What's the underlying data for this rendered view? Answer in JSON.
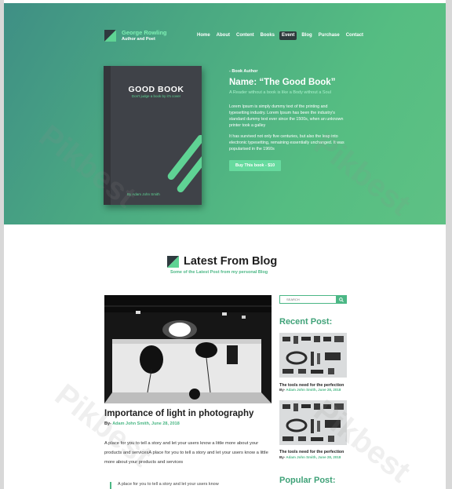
{
  "brand": {
    "name": "George Rowling",
    "role": "Author and Poet"
  },
  "nav": {
    "items": [
      "Home",
      "About",
      "Content",
      "Books",
      "Event",
      "Blog",
      "Purchase",
      "Contact"
    ],
    "active_index": 4
  },
  "book": {
    "title": "GOOD BOOK",
    "subtitle": "Don't judge a book by it's cover",
    "author": "By Adam John Smith"
  },
  "hero": {
    "kicker": "- Book Author",
    "heading": "Name: “The Good Book”",
    "tagline": "A Reader without a book is like a Body without a Soul",
    "para1": "Lorem Ipsum is simply dummy text of the printing and typesetting industry. Lorem Ipsum has been the industry's standard dummy text ever since the 1500s, when an unknown printer took a galley",
    "para2": "It has survived not only five centuries, but also the leap into electronic typesetting, remaining essentially unchanged. It was popularised in the 1960s",
    "buy_label": "Buy This book - $10"
  },
  "blog": {
    "title": "Latest From Blog",
    "subtitle": "Some of the Latest Post from my personal Blog",
    "post": {
      "title": "Importance of light in photography",
      "by": "By-",
      "meta": "Adam John Smith, June 28, 2018",
      "text": "A place for you to tell a story and let your users know a little more about your products and servicesA place for you to tell a story and let your users know a little more about your products and services",
      "quote": "A place for you to tell a story and let your users know"
    }
  },
  "sidebar": {
    "search_placeholder": "SEARCH",
    "recent_heading": "Recent Post:",
    "recent": [
      {
        "title": "The tools need for the perfection",
        "by": "By-",
        "meta": "Adam John Smith, June 28, 2018"
      },
      {
        "title": "The tools need for the perfection",
        "by": "By-",
        "meta": "Adam John Smith, June 28, 2018"
      }
    ],
    "popular_heading": "Popular Post:"
  },
  "watermark": "Pikbest",
  "colors": {
    "accent": "#4bb785",
    "hero_from": "#3f8f85",
    "hero_to": "#5ec184",
    "book": "#3f4248",
    "dark": "#2f3a3f"
  }
}
